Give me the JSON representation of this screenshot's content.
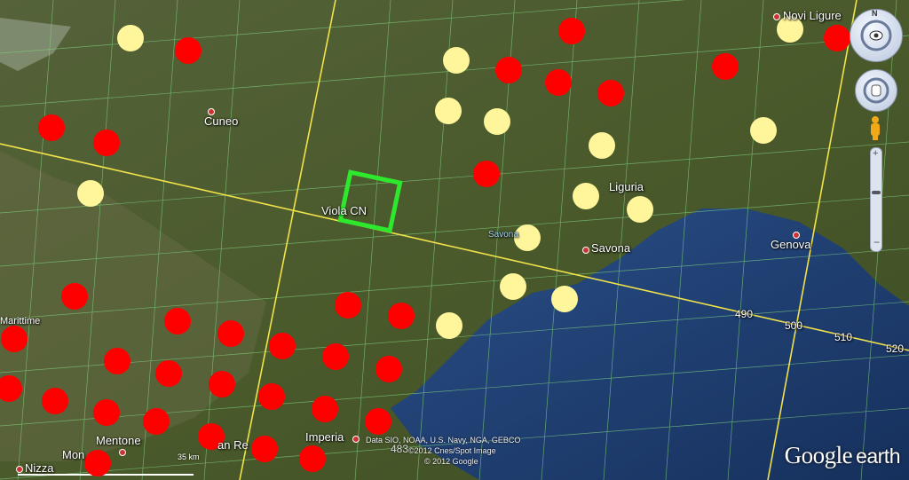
{
  "places": [
    {
      "name": "Novi Ligure",
      "dot": true
    },
    {
      "name": "Cuneo",
      "dot": true
    },
    {
      "name": "Liguria",
      "dot": false
    },
    {
      "name": "Savona",
      "dot": true
    },
    {
      "name": "Genova",
      "dot": true
    },
    {
      "name": "Viola CN",
      "dot": false
    },
    {
      "name": "Savona",
      "dot": false
    },
    {
      "name": "Mentone",
      "dot": true
    },
    {
      "name": "Imperia",
      "dot": true
    },
    {
      "name": "Nizza",
      "dot": true
    },
    {
      "name": "Marittime",
      "dot": false
    },
    {
      "name": "Mon",
      "dot": false
    },
    {
      "name": "an Re",
      "dot": false
    }
  ],
  "grid_labels": [
    "490",
    "500",
    "510",
    "520"
  ],
  "attribution": {
    "line1": "Data SIO, NOAA, U.S. Navy, NGA, GEBCO",
    "line2": "©2012 Cnes/Spot Image",
    "line3": "© 2012 Google",
    "overlap_number": "483"
  },
  "scale_label": "35 km",
  "brand": {
    "google": "Google",
    "earth": "earth"
  },
  "controls": {
    "north_letter": "N"
  },
  "colors": {
    "red_marker": "#ff0000",
    "yellow_marker": "#fff59a",
    "target_box": "#2ee82e",
    "grid_line": "#f1e34a",
    "sea": "#1e3d73",
    "land": "#4b5a2c"
  },
  "markers": {
    "red_count": 33,
    "yellow_count": 16
  }
}
